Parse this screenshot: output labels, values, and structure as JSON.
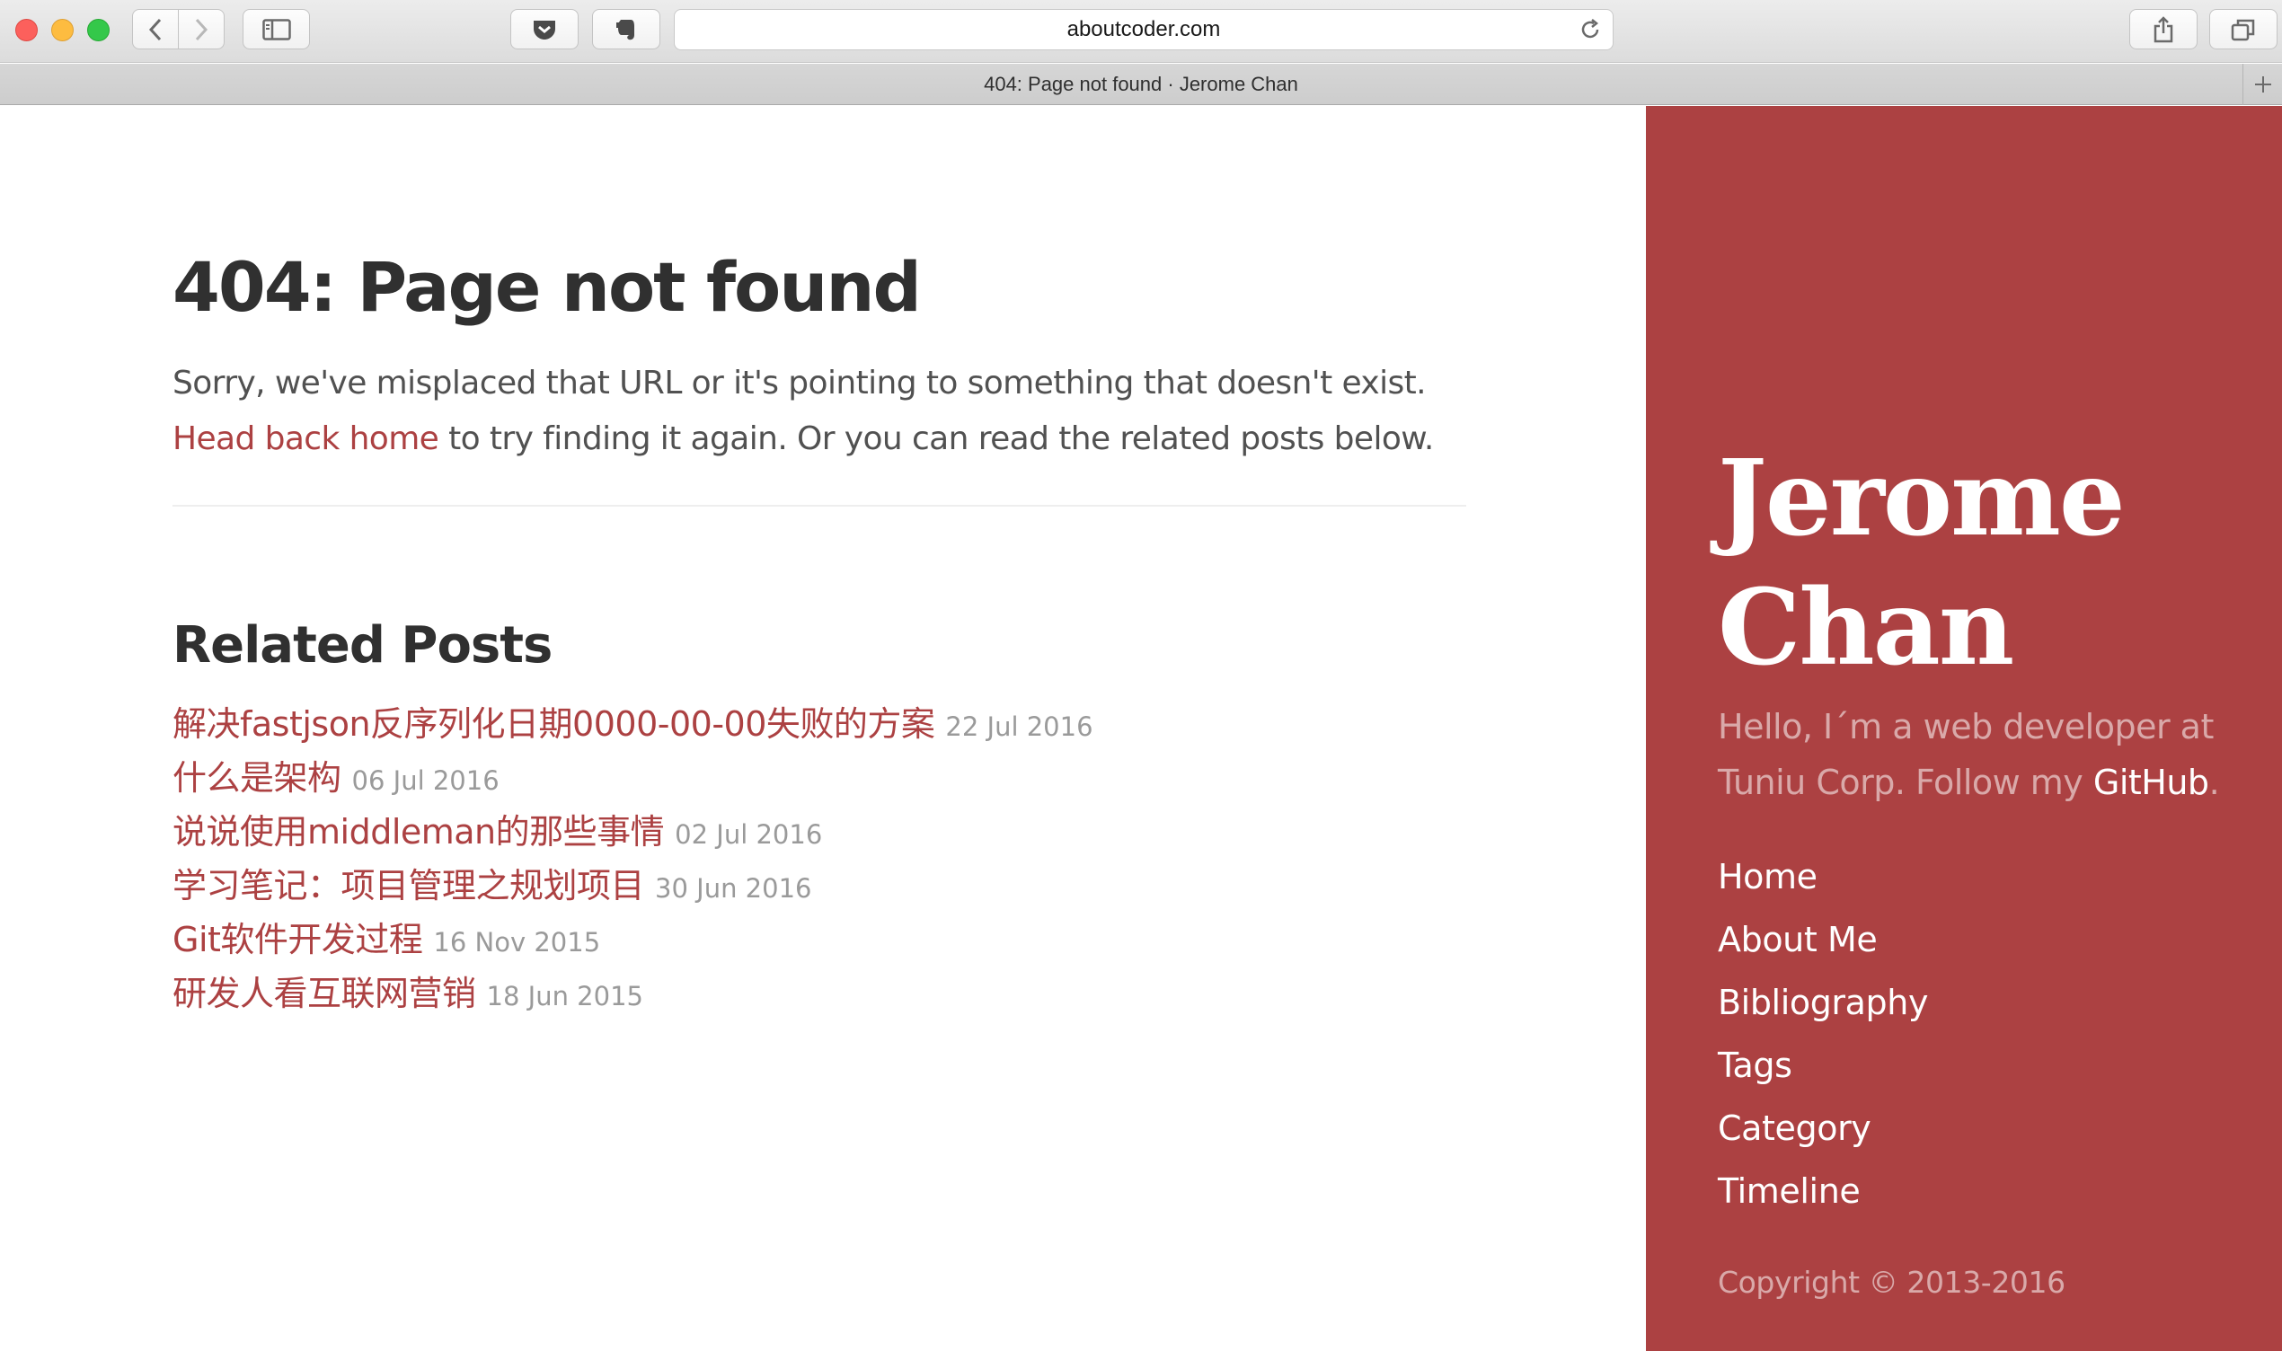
{
  "browser": {
    "url": "aboutcoder.com",
    "tab_title": "404: Page not found · Jerome Chan"
  },
  "main": {
    "title": "404: Page not found",
    "lead_line1": "Sorry, we've misplaced that URL or it's pointing to something that doesn't exist.",
    "lead_link": "Head back home",
    "lead_line2_rest": " to try finding it again. Or you can read the related posts below.",
    "related_title": "Related Posts",
    "related_posts": [
      {
        "title": "解决fastjson反序列化日期0000-00-00失败的方案",
        "date": "22 Jul 2016"
      },
      {
        "title": "什么是架构",
        "date": "06 Jul 2016"
      },
      {
        "title": "说说使用middleman的那些事情",
        "date": "02 Jul 2016"
      },
      {
        "title": "学习笔记：项目管理之规划项目",
        "date": "30 Jun 2016"
      },
      {
        "title": "Git软件开发过程",
        "date": "16 Nov 2015"
      },
      {
        "title": "研发人看互联网营销",
        "date": "18 Jun 2015"
      }
    ]
  },
  "sidebar": {
    "title_line1": "Jerome",
    "title_line2": "Chan",
    "lead_line1": "Hello, I´m a web developer at",
    "lead_line2_prefix": "Tuniu Corp. Follow my ",
    "lead_link": "GitHub",
    "lead_suffix": ".",
    "nav": [
      "Home",
      "About Me",
      "Bibliography",
      "Tags",
      "Category",
      "Timeline"
    ],
    "copyright": "Copyright © 2013-2016"
  },
  "colors": {
    "accent": "#ac4142",
    "sidebar_bg": "#ac4142"
  }
}
